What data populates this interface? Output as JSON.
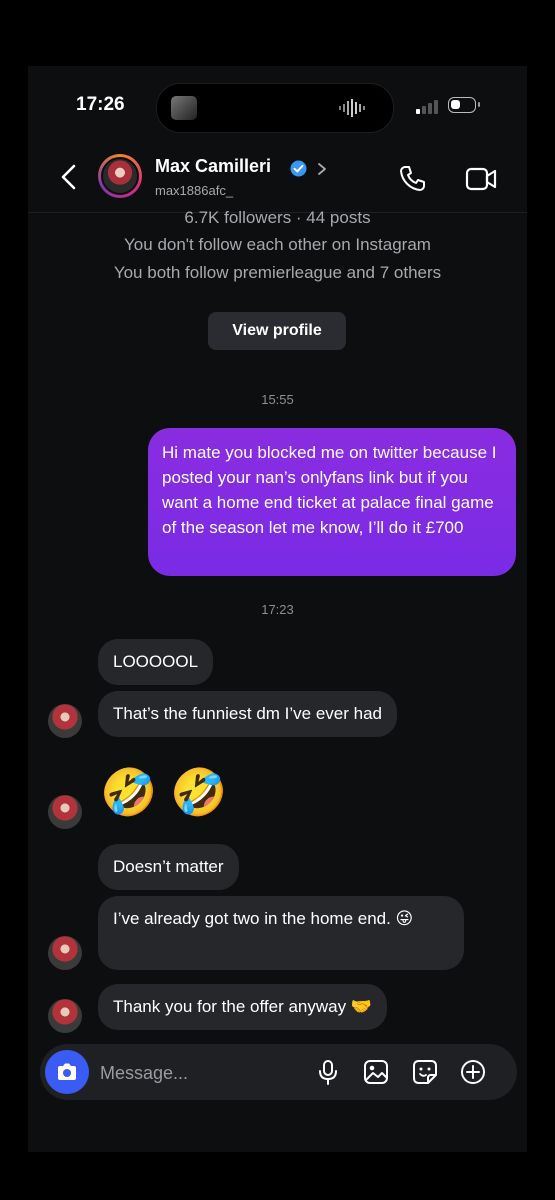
{
  "status_bar": {
    "time": "17:26"
  },
  "header": {
    "name": "Max Camilleri",
    "username": "max1886afc_",
    "verified": true,
    "accent": "#3897f0"
  },
  "profile_info": {
    "stats": "6.7K followers · 44 posts",
    "follow_status": "You don't follow each other on Instagram",
    "mutuals": "You both follow premierleague and 7 others",
    "view_profile_label": "View profile"
  },
  "messages": {
    "timestamp_1": "15:55",
    "sent_1": "Hi mate you blocked me on twitter because I posted your nan’s onlyfans link but if you want a home end ticket at palace final game of the season let me know, I’ll do it £700",
    "timestamp_2": "17:23",
    "received_1": "LOOOOOL",
    "received_2": "That’s the funniest dm I’ve ever had",
    "received_3_emoji_1": "🤣",
    "received_3_emoji_2": "🤣",
    "received_4": "Doesn’t matter",
    "received_5": "I’ve already got two in the home end. 😜",
    "received_6": "Thank you for the offer anyway 🤝",
    "sent_bubble_color": "#8a2ce0",
    "received_bubble_color": "#26272b"
  },
  "composer": {
    "placeholder": "Message...",
    "camera_color": "#3b5bf5",
    "icons": [
      "microphone-icon",
      "gallery-icon",
      "sticker-icon",
      "plus-icon"
    ]
  }
}
